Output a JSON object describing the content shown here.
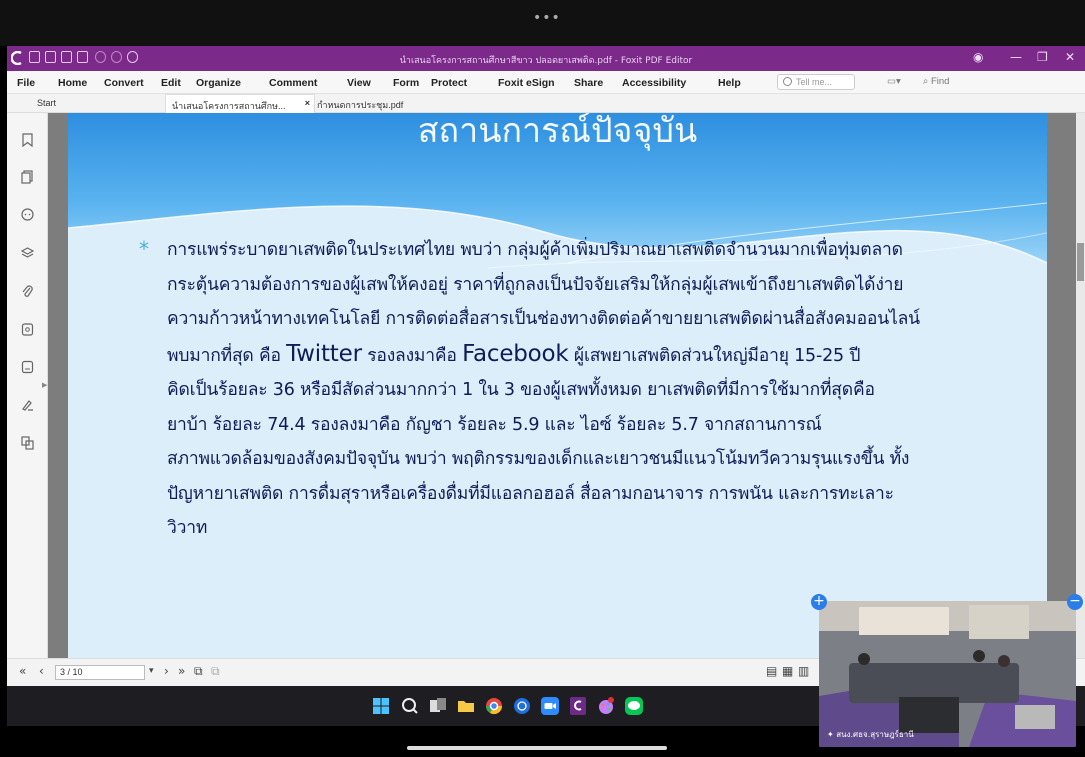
{
  "top_indicator": "•••",
  "app": {
    "window_title": "นำเสนอโครงการสถานศึกษาสีขาว ปลอดยาเสพติด.pdf - Foxit PDF Editor",
    "menu": [
      "File",
      "Home",
      "Convert",
      "Edit",
      "Organize",
      "Comment",
      "View",
      "Form",
      "Protect",
      "Foxit eSign",
      "Share",
      "Accessibility",
      "Help"
    ],
    "tell_me_placeholder": "Tell me...",
    "find_placeholder": "Find",
    "tabs": {
      "start": "Start",
      "active": "นำเสนอโครงการสถานศึกษ...",
      "active_close": "×",
      "second": "กำหนดการประชุม.pdf"
    }
  },
  "slide": {
    "title": "สถานการณ์ปัจจุบัน",
    "bullet": "*",
    "lines": [
      "การแพร่ระบาดยาเสพติดในประเทศไทย พบว่า กลุ่มผู้ค้าเพิ่มปริมาณยาเสพติดจำนวนมากเพื่อทุ่มตลาด",
      "กระตุ้นความต้องการของผู้เสพให้คงอยู่ ราคาที่ถูกลงเป็นปัจจัยเสริมให้กลุ่มผู้เสพเข้าถึงยาเสพติดได้ง่าย",
      "ความก้าวหน้าทางเทคโนโลยี การติดต่อสื่อสารเป็นช่องทางติดต่อค้าขายยาเสพติดผ่านสื่อสังคมออนไลน์"
    ],
    "line4": {
      "a": "พบมากที่สุด คือ ",
      "b": "Twitter",
      "c": " รองลงมาคือ ",
      "d": "Facebook",
      "e": " ผู้เสพยาเสพติดส่วนใหญ่มีอายุ 15-25 ปี"
    },
    "lines_rest": [
      "คิดเป็นร้อยละ 36 หรือมีสัดส่วนมากกว่า 1 ใน 3 ของผู้เสพทั้งหมด ยาเสพติดที่มีการใช้มากที่สุดคือ",
      "ยาบ้า ร้อยละ 74.4 รองลงมาคือ กัญชา ร้อยละ  5.9 และ ไอซ์ ร้อยละ 5.7 จากสถานการณ์",
      "สภาพแวดล้อมของสังคมปัจจุบัน พบว่า พฤติกรรมของเด็กและเยาวชนมีแนวโน้มทวีความรุนแรงขึ้น ทั้ง",
      "ปัญหายาเสพติด การดื่มสุราหรือเครื่องดื่มที่มีแอลกอฮอล์ สื่อลามกอนาจาร การพนัน และการทะเลาะ",
      "วิวาท"
    ]
  },
  "status": {
    "page_indicator": "3 / 10"
  },
  "video": {
    "participant_label": "สนง.ศธจ.สุราษฎร์ธานี"
  },
  "colors": {
    "titlebar": "#7b2a8a",
    "slide_text": "#0d1d58",
    "bullet": "#4ab0d9"
  }
}
